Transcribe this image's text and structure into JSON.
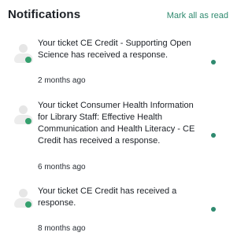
{
  "header": {
    "title": "Notifications",
    "mark_all_label": "Mark all as read"
  },
  "notifications": [
    {
      "message": "Your ticket CE Credit - Supporting Open Science has received a response.",
      "time": "2 months ago",
      "unread": true
    },
    {
      "message": "Your ticket Consumer Health Information for Library Staff: Effective Health Communication and Health Literacy - CE Credit has received a response.",
      "time": "6 months ago",
      "unread": true
    },
    {
      "message": "Your ticket CE Credit has received a response.",
      "time": "8 months ago",
      "unread": true
    }
  ],
  "colors": {
    "accent": "#2f8a6f",
    "unread_dot": "#35a06e"
  }
}
